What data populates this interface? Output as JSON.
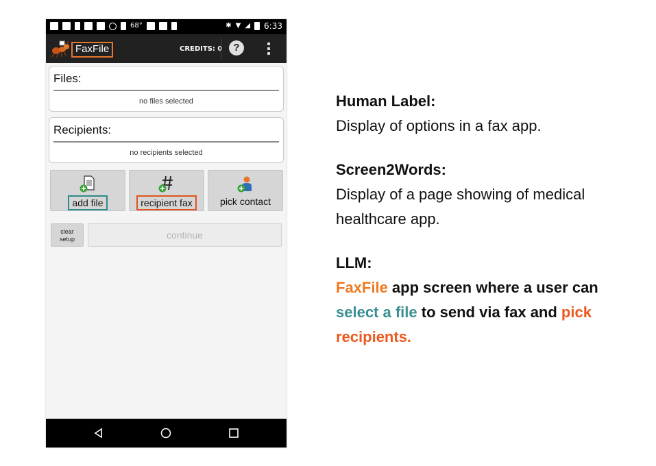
{
  "status_bar": {
    "temp": "68°",
    "time": "6:33"
  },
  "app_bar": {
    "title": "FaxFile",
    "credits": "CREDITS: 0",
    "help_glyph": "?"
  },
  "files_card": {
    "title": "Files:",
    "status": "no files selected"
  },
  "recipients_card": {
    "title": "Recipients:",
    "status": "no recipients selected"
  },
  "actions": {
    "add_file": "add file",
    "recipient_fax": "recipient fax",
    "pick_contact": "pick contact"
  },
  "buttons": {
    "clear_line1": "clear",
    "clear_line2": "setup",
    "continue": "continue"
  },
  "annotations": {
    "human_label_heading": "Human Label:",
    "human_label_text": "Display of options in a fax app.",
    "screen2words_heading": "Screen2Words:",
    "screen2words_text": "Display of a page showing of medical healthcare app.",
    "llm_heading": "LLM:",
    "llm_part1": "FaxFile",
    "llm_part2": " app screen where a user can ",
    "llm_part3": "select a file",
    "llm_part4": " to send via fax and ",
    "llm_part5": "pick recipients."
  },
  "colors": {
    "appbar": "#212121",
    "highlight_orange": "#e5742c",
    "highlight_teal": "#2e8a8a",
    "highlight_red": "#e0531f"
  }
}
